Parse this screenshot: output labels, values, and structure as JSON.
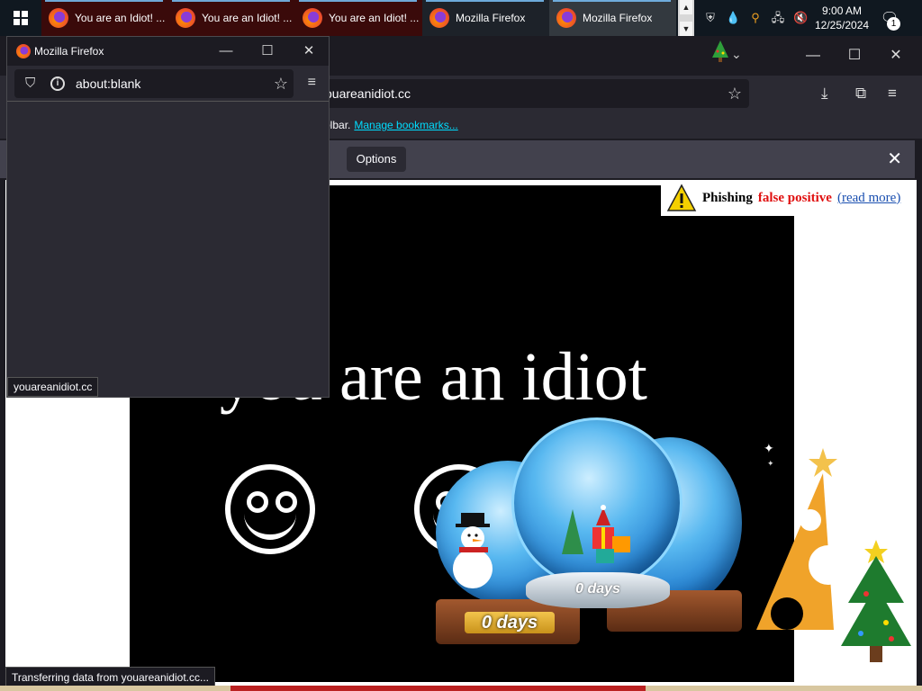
{
  "taskbar": {
    "tasks": [
      {
        "label": "You are an Idiot! ...",
        "kind": "idiot"
      },
      {
        "label": "You are an Idiot! ...",
        "kind": "idiot"
      },
      {
        "label": "You are an Idiot! ...",
        "kind": "idiot"
      },
      {
        "label": "Mozilla Firefox",
        "kind": "ff"
      },
      {
        "label": "Mozilla Firefox",
        "kind": "ff"
      }
    ],
    "clock_time": "9:00 AM",
    "clock_date": "12/25/2024",
    "notification_count": "1",
    "tray_icons": [
      "defender-icon",
      "drop-icon",
      "search-icon",
      "network-icon",
      "volume-muted-icon"
    ]
  },
  "main_window": {
    "url": "youareanidiot.cc",
    "bookmarks_text": "olbar.",
    "bookmarks_link": "Manage bookmarks...",
    "notification_options": "Options",
    "status": "Transferring data from youareanidiot.cc..."
  },
  "page": {
    "headline": "you are an idiot",
    "phishing_label": "Phishing",
    "phishing_flag": "false positive",
    "read_more": "(read more)",
    "globe_label": "0 days"
  },
  "popup": {
    "title": "Mozilla Firefox",
    "url": "about:blank",
    "status": "youareanidiot.cc"
  },
  "colors": {
    "taskbar": "#101820",
    "firefox_dark": "#1c1b22",
    "firefox_toolbar": "#2b2a33",
    "link": "#00ddff",
    "warning_red": "#e01010"
  }
}
